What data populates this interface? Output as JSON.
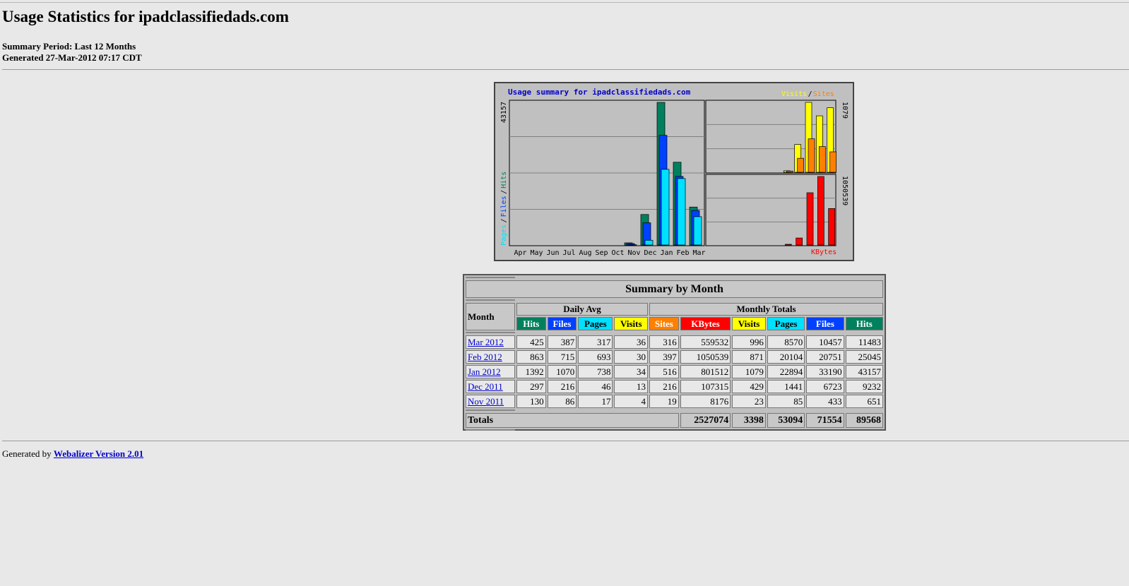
{
  "page": {
    "title": "Usage Statistics for ipadclassifiedads.com",
    "summary_period": "Summary Period: Last 12 Months",
    "generated": "Generated 27-Mar-2012 07:17 CDT",
    "footer_prefix": "Generated by",
    "footer_link": "Webalizer Version 2.01"
  },
  "colors": {
    "hits": "#00805c",
    "files": "#0040ff",
    "pages": "#00e0ff",
    "visits": "#ffff00",
    "sites": "#ff8000",
    "kbytes": "#ff0000",
    "title_blue": "#0000cc"
  },
  "chart_data": {
    "type": "bar",
    "title": "Usage summary for ipadclassifiedads.com",
    "categories": [
      "Apr",
      "May",
      "Jun",
      "Jul",
      "Aug",
      "Sep",
      "Oct",
      "Nov",
      "Dec",
      "Jan",
      "Feb",
      "Mar"
    ],
    "left_axis_max_label": "43157",
    "left_axis_label_parts": [
      "Pages",
      "/",
      "Files",
      "/",
      "Hits"
    ],
    "right_top_max_label": "1079",
    "right_top_legend": [
      "Visits",
      "/",
      "Sites"
    ],
    "right_bottom_max_label": "1050539",
    "right_bottom_legend": "KBytes",
    "series": [
      {
        "name": "Hits",
        "values": [
          0,
          0,
          0,
          0,
          0,
          0,
          0,
          651,
          9232,
          43157,
          25045,
          11483
        ]
      },
      {
        "name": "Files",
        "values": [
          0,
          0,
          0,
          0,
          0,
          0,
          0,
          433,
          6723,
          33190,
          20751,
          10457
        ]
      },
      {
        "name": "Pages",
        "values": [
          0,
          0,
          0,
          0,
          0,
          0,
          0,
          85,
          1441,
          22894,
          20104,
          8570
        ]
      },
      {
        "name": "Visits",
        "values": [
          0,
          0,
          0,
          0,
          0,
          0,
          0,
          23,
          429,
          1079,
          871,
          996
        ]
      },
      {
        "name": "Sites",
        "values": [
          0,
          0,
          0,
          0,
          0,
          0,
          0,
          19,
          216,
          516,
          397,
          316
        ]
      },
      {
        "name": "KBytes",
        "values": [
          0,
          0,
          0,
          0,
          0,
          0,
          0,
          8176,
          107315,
          801512,
          1050539,
          559532
        ]
      }
    ]
  },
  "table": {
    "title": "Summary by Month",
    "month_header": "Month",
    "daily_avg": "Daily Avg",
    "monthly_totals": "Monthly Totals",
    "columns": [
      "Hits",
      "Files",
      "Pages",
      "Visits",
      "Sites",
      "KBytes",
      "Visits",
      "Pages",
      "Files",
      "Hits"
    ],
    "rows": [
      {
        "month": "Mar 2012",
        "vals": [
          "425",
          "387",
          "317",
          "36",
          "316",
          "559532",
          "996",
          "8570",
          "10457",
          "11483"
        ]
      },
      {
        "month": "Feb 2012",
        "vals": [
          "863",
          "715",
          "693",
          "30",
          "397",
          "1050539",
          "871",
          "20104",
          "20751",
          "25045"
        ]
      },
      {
        "month": "Jan 2012",
        "vals": [
          "1392",
          "1070",
          "738",
          "34",
          "516",
          "801512",
          "1079",
          "22894",
          "33190",
          "43157"
        ]
      },
      {
        "month": "Dec 2011",
        "vals": [
          "297",
          "216",
          "46",
          "13",
          "216",
          "107315",
          "429",
          "1441",
          "6723",
          "9232"
        ]
      },
      {
        "month": "Nov 2011",
        "vals": [
          "130",
          "86",
          "17",
          "4",
          "19",
          "8176",
          "23",
          "85",
          "433",
          "651"
        ]
      }
    ],
    "totals_label": "Totals",
    "totals": [
      "2527074",
      "3398",
      "53094",
      "71554",
      "89568"
    ]
  }
}
